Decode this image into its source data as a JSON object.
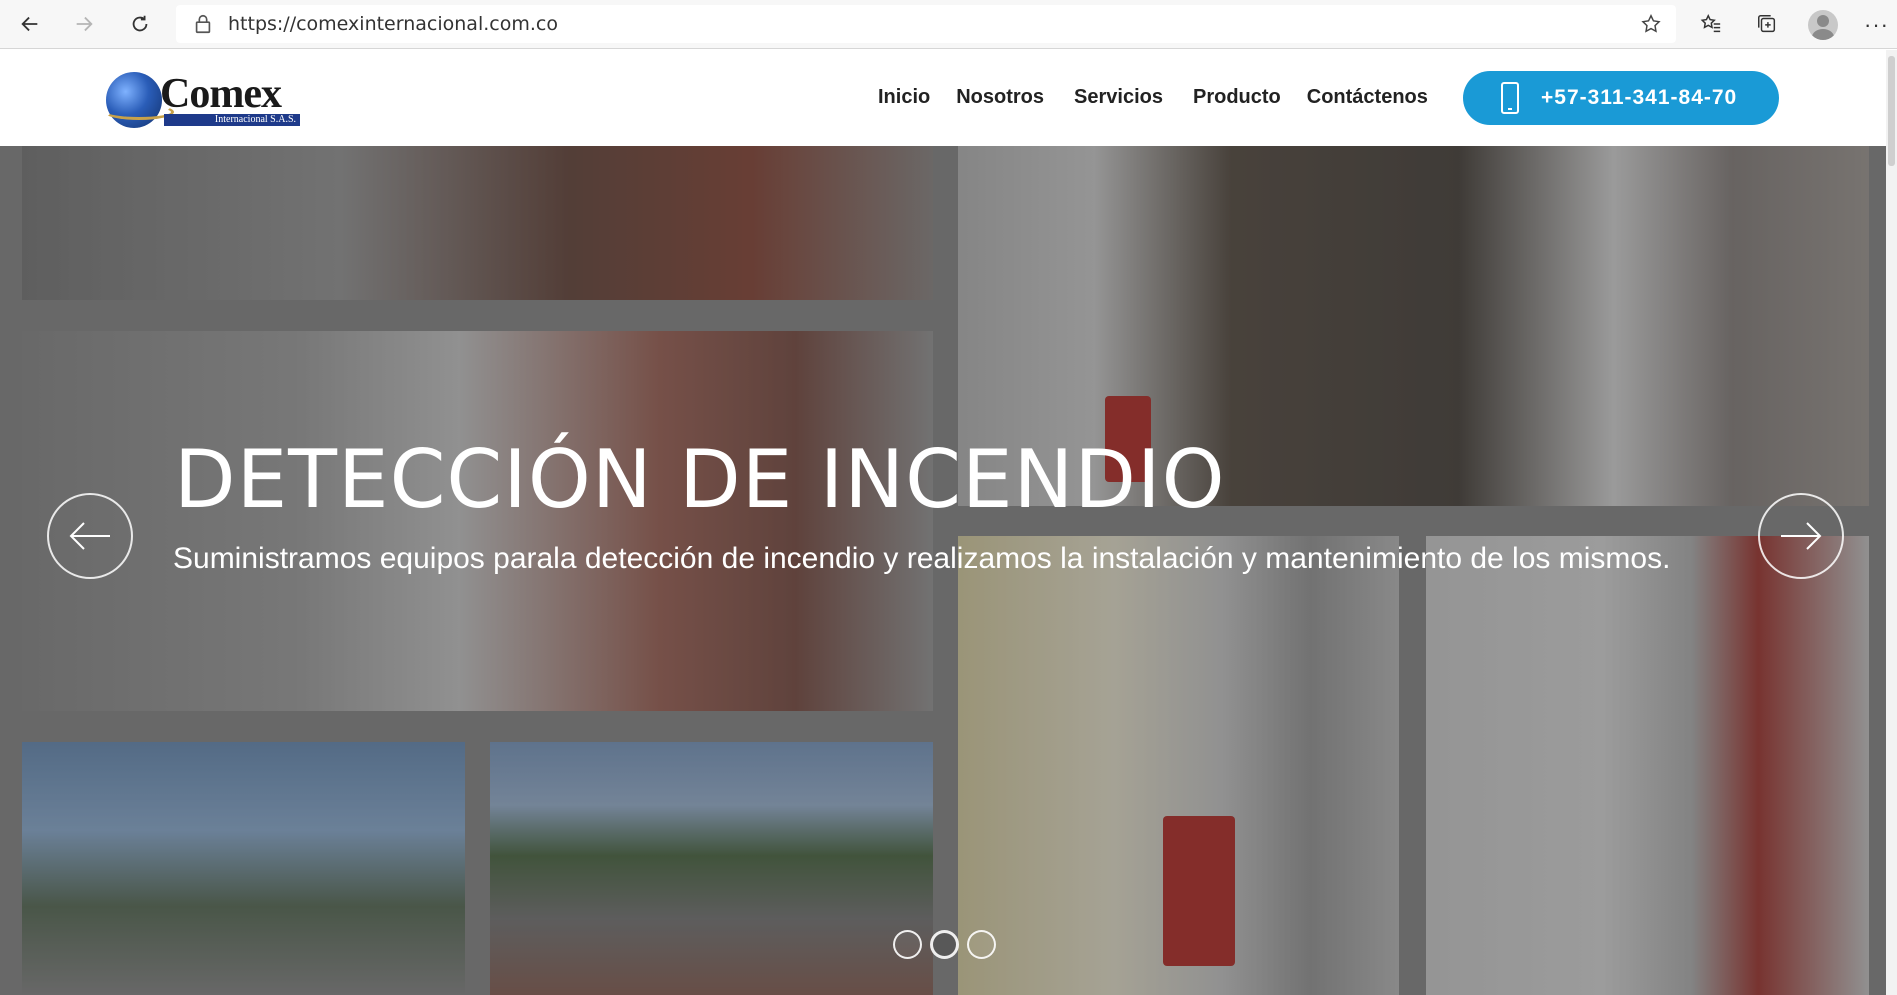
{
  "browser": {
    "url": "https://comexinternacional.com.co",
    "more": "···"
  },
  "header": {
    "logo": {
      "brand": "Comex",
      "sub": "Internacional S.A.S."
    },
    "menu": [
      "Inicio",
      "Nosotros",
      "Servicios",
      "Producto",
      "Contáctenos"
    ],
    "phone": "+57-311-341-84-70",
    "accent_color": "#1a9ad6"
  },
  "hero": {
    "title": "DETECCIÓN DE INCENDIO",
    "subtitle": "Suministramos equipos parala detección de incendio y realizamos la instalación y mantenimiento de los mismos.",
    "slides_total": 3,
    "active_slide": 2
  }
}
